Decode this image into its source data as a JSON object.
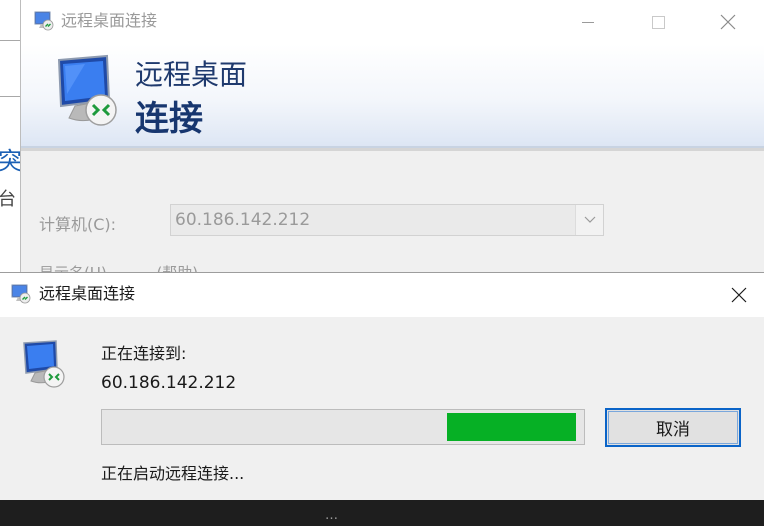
{
  "background": {
    "fragment_top": "突",
    "fragment_bottom": "台",
    "bottom_text": "…"
  },
  "main_window": {
    "title": "远程桌面连接",
    "banner_line1": "远程桌面",
    "banner_line2": "连接",
    "computer_label": "计算机(C):",
    "computer_value": "60.186.142.212",
    "partial_text": "显示名(U) 　　　(帮助)",
    "controls": {
      "minimize": "minimize",
      "maximize": "maximize",
      "close": "close"
    }
  },
  "dialog": {
    "title": "远程桌面连接",
    "connecting_to": "正在连接到:",
    "address": "60.186.142.212",
    "progress": {
      "segment_start": 0.716,
      "segment_end": 0.983,
      "color": "#06b025"
    },
    "cancel_label": "取消",
    "status": "正在启动远程连接..."
  },
  "icons": [
    "remote-desktop-icon",
    "close-icon",
    "minimize-icon",
    "maximize-icon",
    "chevron-down-icon"
  ],
  "colors": {
    "accent": "#0a64c8",
    "banner_text": "#17366f",
    "progress": "#06b025"
  }
}
